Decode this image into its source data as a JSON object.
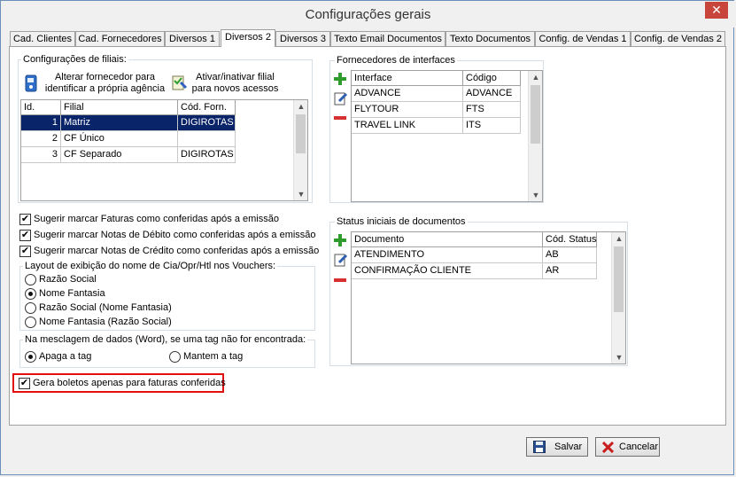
{
  "window": {
    "title": "Configurações gerais",
    "close_glyph": "✕"
  },
  "tabs": [
    {
      "label": "Cad. Clientes"
    },
    {
      "label": "Cad. Fornecedores"
    },
    {
      "label": "Diversos 1"
    },
    {
      "label": "Diversos 2"
    },
    {
      "label": "Diversos 3"
    },
    {
      "label": "Texto Email Documentos"
    },
    {
      "label": "Texto Documentos"
    },
    {
      "label": "Config. de Vendas 1"
    },
    {
      "label": "Config. de Vendas 2"
    }
  ],
  "filiais": {
    "group_label": "Configurações de filiais:",
    "btn_alterar": {
      "line1": "Alterar fornecedor para",
      "line2": "identificar a própria agência"
    },
    "btn_ativar": {
      "line1": "Ativar/inativar filial",
      "line2": "para novos acessos"
    },
    "columns": [
      "Id.",
      "Filial",
      "Cód. Forn."
    ],
    "rows": [
      {
        "id": "1",
        "filial": "Matriz",
        "cod": "DIGIROTAS"
      },
      {
        "id": "2",
        "filial": "CF Único",
        "cod": ""
      },
      {
        "id": "3",
        "filial": "CF Separado",
        "cod": "DIGIROTAS"
      }
    ]
  },
  "fornecedores": {
    "group_label": "Fornecedores de interfaces",
    "columns": [
      "Interface",
      "Código"
    ],
    "rows": [
      {
        "interface": "ADVANCE",
        "codigo": "ADVANCE"
      },
      {
        "interface": "FLYTOUR",
        "codigo": "FTS"
      },
      {
        "interface": "TRAVEL LINK",
        "codigo": "ITS"
      }
    ]
  },
  "status": {
    "group_label": "Status iniciais de documentos",
    "columns": [
      "Documento",
      "Cód. Status"
    ],
    "rows": [
      {
        "documento": "ATENDIMENTO",
        "codigo": "AB"
      },
      {
        "documento": "CONFIRMAÇÃO CLIENTE",
        "codigo": "AR"
      }
    ]
  },
  "checks": {
    "faturas": "Sugerir marcar Faturas como conferidas após a emissão",
    "debito": "Sugerir marcar Notas de Débito como conferidas após a emissão",
    "credito": "Sugerir marcar Notas de Crédito como conferidas após a emissão",
    "boletos": "Gera boletos apenas para faturas conferidas",
    "mark": "✔"
  },
  "layout_vouchers": {
    "label": "Layout de exibição do nome de Cia/Opr/Htl nos Vouchers:",
    "options": [
      "Razão Social",
      "Nome Fantasia",
      "Razão Social (Nome Fantasia)",
      "Nome Fantasia (Razão Social)"
    ],
    "selected": "Nome Fantasia"
  },
  "mesclagem": {
    "label": "Na mesclagem de dados (Word), se uma tag não for encontrada:",
    "options": [
      "Apaga a tag",
      "Mantem a tag"
    ],
    "selected": "Apaga a tag"
  },
  "footer": {
    "save": "Salvar",
    "cancel": "Cancelar"
  },
  "colors": {
    "selection": "#0a246a",
    "highlight": "#e01010",
    "add": "#2e9d2e",
    "remove": "#d83030"
  }
}
